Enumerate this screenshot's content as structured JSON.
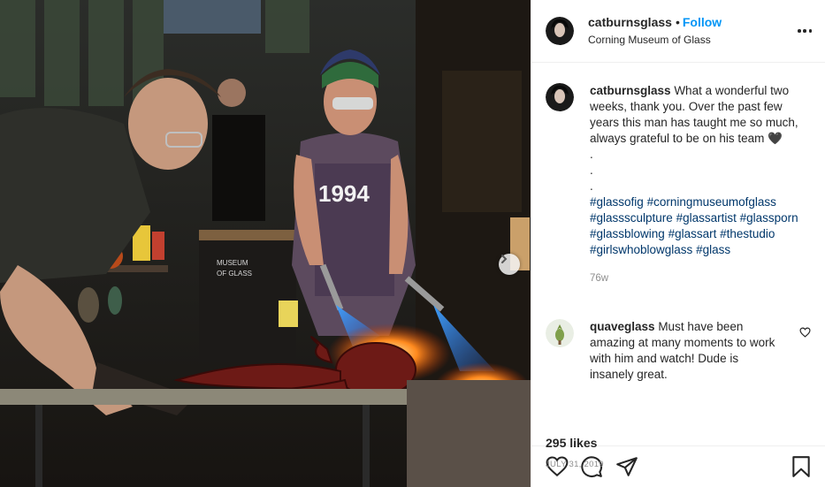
{
  "photo": {
    "alt_icons": [
      "next-arrow-icon"
    ],
    "jersey_text": "1994",
    "machine_text": "MUSEUM OF GLASS"
  },
  "header": {
    "username": "catburnsglass",
    "separator": "•",
    "follow_label": "Follow",
    "location": "Corning Museum of Glass"
  },
  "caption": {
    "username": "catburnsglass",
    "text": "What a wonderful two weeks, thank you. Over the past few years this man has taught me so much, always grateful to be on his team",
    "emoji": "🖤",
    "dots": [
      ".",
      ".",
      "."
    ],
    "hashtags": [
      "#glassofig",
      "#corningmuseumofglass",
      "#glasssculpture",
      "#glassartist",
      "#glassporn",
      "#glassblowing",
      "#glassart",
      "#thestudio",
      "#girlswhoblowglass",
      "#glass"
    ],
    "age": "76w"
  },
  "comment": {
    "username": "quaveglass",
    "text": "Must have been amazing at many moments to work with him and watch! Dude is insanely great."
  },
  "actions": {
    "icons": [
      "heart-icon",
      "comment-icon",
      "share-icon",
      "bookmark-icon"
    ]
  },
  "likes": "295 likes",
  "date": "JULY 31, 2019",
  "colors": {
    "link": "#0095f6",
    "hashtag": "#00376b",
    "muted": "#8e8e8e",
    "border": "#efefef"
  }
}
